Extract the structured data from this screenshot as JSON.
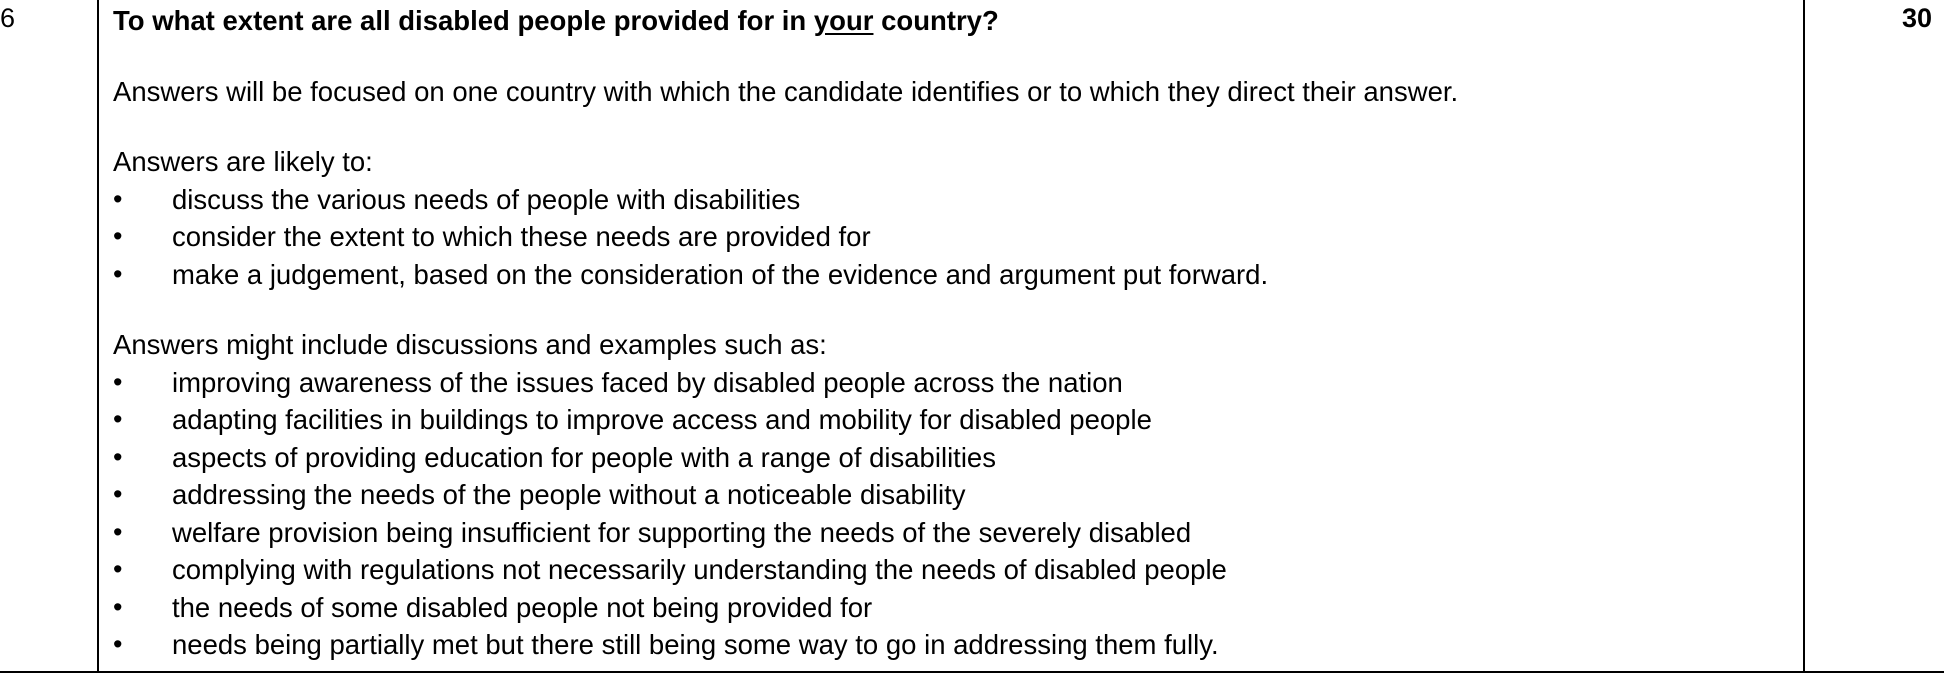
{
  "question": {
    "number": "6",
    "marks": "30",
    "title_before": "To what extent are all disabled people provided for in ",
    "title_underlined": "your",
    "title_after": " country?"
  },
  "intro": "Answers will be focused on one country with which the candidate identifies or to which they direct their answer.",
  "likely": {
    "heading": "Answers are likely to:",
    "items": [
      "discuss the various needs of people with disabilities",
      "consider the extent to which these needs are provided for",
      "make a judgement, based on the consideration of the evidence and argument put forward."
    ]
  },
  "examples": {
    "heading": "Answers might include discussions and examples such as:",
    "items": [
      "improving awareness of the issues faced by disabled people across the nation",
      "adapting facilities in buildings to improve access and mobility for disabled people",
      "aspects of providing education for people with a range of disabilities",
      "addressing the needs of the people without a noticeable disability",
      "welfare provision being insufficient for supporting the needs of the severely disabled",
      "complying with regulations not necessarily understanding the needs of disabled people",
      "the needs of some disabled people not being provided for",
      "needs being partially met but there still being some way to go in addressing them fully."
    ]
  }
}
